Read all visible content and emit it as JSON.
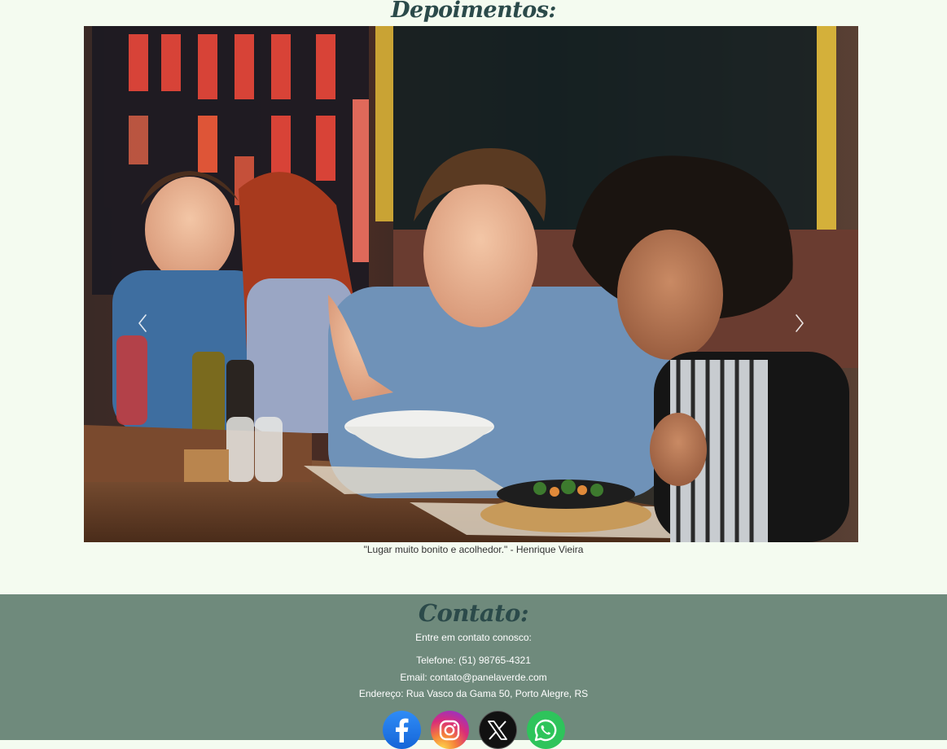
{
  "testimonials": {
    "title": "Depoimentos:",
    "caption": "\"Lugar muito bonito e acolhedor.\" - Henrique Vieira",
    "prev_icon": "chevron-left-icon",
    "next_icon": "chevron-right-icon"
  },
  "contact": {
    "title": "Contato:",
    "intro": "Entre em contato conosco:",
    "phone": "Telefone: (51) 98765-4321",
    "email": "Email: contato@panelaverde.com",
    "address": "Endereço: Rua Vasco da Gama 50, Porto Alegre, RS"
  },
  "social": [
    "facebook-icon",
    "instagram-icon",
    "x-icon",
    "whatsapp-icon"
  ],
  "colors": {
    "page_bg": "#f4fbf0",
    "contact_bg": "#6f8a7c",
    "title": "#2b4a4a"
  }
}
